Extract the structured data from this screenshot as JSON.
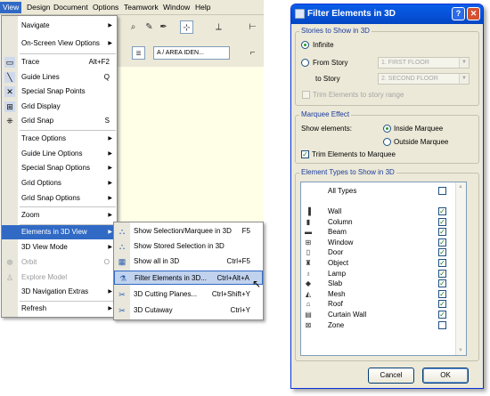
{
  "menubar": {
    "items": [
      "View",
      "Design",
      "Document",
      "Options",
      "Teamwork",
      "Window",
      "Help"
    ]
  },
  "toolbar": {
    "layer_value": "A / AREA IDEN..."
  },
  "view_menu": {
    "items": [
      {
        "label": "Navigate",
        "submenu": true
      },
      {
        "label": "On-Screen View Options",
        "submenu": true
      },
      {
        "label": "Trace",
        "shortcut": "Alt+F2",
        "icon": "trace-icon"
      },
      {
        "label": "Guide Lines",
        "shortcut": "Q",
        "icon": "guide-lines-icon"
      },
      {
        "label": "Special Snap Points",
        "icon": "snap-points-icon"
      },
      {
        "label": "Grid Display",
        "icon": "grid-display-icon"
      },
      {
        "label": "Grid Snap",
        "shortcut": "S",
        "icon": "grid-snap-icon"
      },
      {
        "label": "Trace Options",
        "submenu": true
      },
      {
        "label": "Guide Line Options",
        "submenu": true
      },
      {
        "label": "Special Snap Options",
        "submenu": true
      },
      {
        "label": "Grid Options",
        "submenu": true
      },
      {
        "label": "Grid Snap Options",
        "submenu": true
      },
      {
        "label": "Zoom",
        "submenu": true
      },
      {
        "label": "Elements in 3D View",
        "submenu": true
      },
      {
        "label": "3D View Mode",
        "submenu": true
      },
      {
        "label": "Orbit",
        "shortcut": "O"
      },
      {
        "label": "Explore Model"
      },
      {
        "label": "3D Navigation Extras",
        "submenu": true
      },
      {
        "label": "Refresh",
        "submenu": true
      }
    ]
  },
  "submenu": {
    "items": [
      {
        "label": "Show Selection/Marquee in 3D",
        "shortcut": "F5"
      },
      {
        "label": "Show Stored Selection in 3D",
        "shortcut": ""
      },
      {
        "label": "Show all in 3D",
        "shortcut": "Ctrl+F5"
      },
      {
        "label": "Filter Elements in 3D...",
        "shortcut": "Ctrl+Alt+A"
      },
      {
        "label": "3D Cutting Planes...",
        "shortcut": "Ctrl+Shift+Y"
      },
      {
        "label": "3D Cutaway",
        "shortcut": "Ctrl+Y"
      }
    ]
  },
  "dialog": {
    "title": "Filter Elements in 3D",
    "help_label": "?",
    "close_label": "✕",
    "stories": {
      "title": "Stories to Show in 3D",
      "infinite": "Infinite",
      "from_story": "From Story",
      "from_value": "1. FIRST FLOOR",
      "to_story": "to Story",
      "to_value": "2. SECOND FLOOR",
      "trim_range": "Trim Elements to story range"
    },
    "marquee": {
      "title": "Marquee Effect",
      "show_elements": "Show elements:",
      "inside": "Inside Marquee",
      "outside": "Outside Marquee",
      "trim": "Trim Elements to Marquee"
    },
    "types": {
      "title": "Element Types to Show in 3D",
      "all_types": "All Types",
      "items": [
        {
          "label": "Wall",
          "checked": true
        },
        {
          "label": "Column",
          "checked": true
        },
        {
          "label": "Beam",
          "checked": true
        },
        {
          "label": "Window",
          "checked": true
        },
        {
          "label": "Door",
          "checked": true
        },
        {
          "label": "Object",
          "checked": true
        },
        {
          "label": "Lamp",
          "checked": true
        },
        {
          "label": "Slab",
          "checked": true
        },
        {
          "label": "Mesh",
          "checked": true
        },
        {
          "label": "Roof",
          "checked": true
        },
        {
          "label": "Curtain Wall",
          "checked": true
        },
        {
          "label": "Zone",
          "checked": false
        }
      ]
    },
    "cancel_label": "Cancel",
    "ok_label": "OK"
  }
}
